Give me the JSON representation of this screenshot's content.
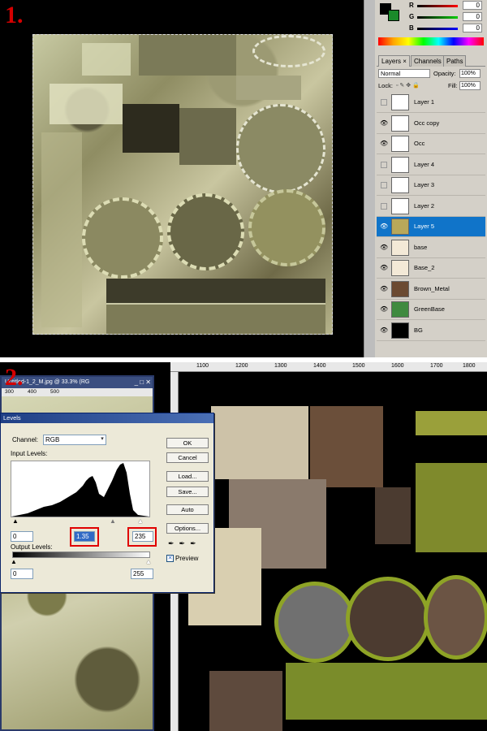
{
  "step1": {
    "number": "1.",
    "color_panel": {
      "r_label": "R",
      "g_label": "G",
      "b_label": "B",
      "r_value": "0",
      "g_value": "0",
      "b_value": "0",
      "foreground_color": "#000000",
      "background_color": "#1a8a2a"
    },
    "layers_panel": {
      "tabs": [
        "Layers ×",
        "Channels",
        "Paths"
      ],
      "blend_mode": "Normal",
      "opacity_label": "Opacity:",
      "opacity_value": "100%",
      "lock_label": "Lock:",
      "fill_label": "Fill:",
      "fill_value": "100%",
      "layers": [
        {
          "name": "Layer 1",
          "visible": false,
          "selected": false
        },
        {
          "name": "Occ copy",
          "visible": true,
          "selected": false
        },
        {
          "name": "Occ",
          "visible": true,
          "selected": false
        },
        {
          "name": "Layer 4",
          "visible": false,
          "selected": false
        },
        {
          "name": "Layer 3",
          "visible": false,
          "selected": false
        },
        {
          "name": "Layer 2",
          "visible": false,
          "selected": false
        },
        {
          "name": "Layer 5",
          "visible": true,
          "selected": true
        },
        {
          "name": "base",
          "visible": true,
          "selected": false
        },
        {
          "name": "Base_2",
          "visible": true,
          "selected": false
        },
        {
          "name": "Brown_Metal",
          "visible": true,
          "selected": false
        },
        {
          "name": "GreenBase",
          "visible": true,
          "selected": false
        },
        {
          "name": "BG",
          "visible": true,
          "selected": false
        }
      ]
    }
  },
  "step2": {
    "number": "2.",
    "bg_window_title": "Untitled-1_2_M.jpg @ 33.3% (RG",
    "bg_window_ruler": [
      "300",
      "400",
      "500"
    ],
    "top_ruler": [
      "1100",
      "1200",
      "1300",
      "1400",
      "1500",
      "1600",
      "1700",
      "1800"
    ],
    "levels": {
      "title": "Levels",
      "channel_label": "Channel:",
      "channel_value": "RGB",
      "input_levels_label": "Input Levels:",
      "input_black": "0",
      "input_mid": "1.35",
      "input_white": "235",
      "output_levels_label": "Output Levels:",
      "output_black": "0",
      "output_white": "255",
      "buttons": [
        "OK",
        "Cancel",
        "Load...",
        "Save...",
        "Auto",
        "Options..."
      ],
      "preview_label": "Preview",
      "preview_checked": true,
      "highlight_color": "#e00000"
    }
  }
}
